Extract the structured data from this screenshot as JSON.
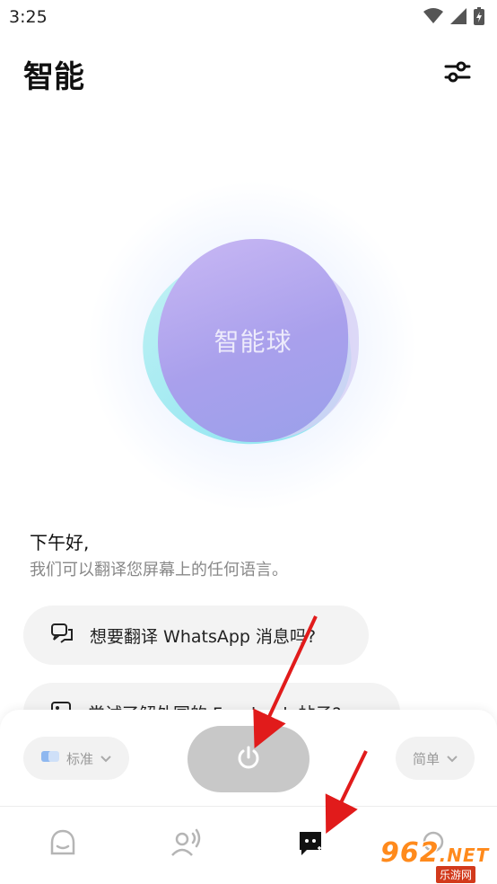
{
  "status_bar": {
    "time": "3:25"
  },
  "header": {
    "title": "智能"
  },
  "orb": {
    "label": "智能球"
  },
  "greeting": {
    "title": "下午好,",
    "subtitle": "我们可以翻译您屏幕上的任何语言。"
  },
  "suggestions": [
    {
      "label": "想要翻译 WhatsApp 消息吗?",
      "icon": "chat-bubbles-icon"
    },
    {
      "label": "尝试了解外国的 Facebook 帖子?",
      "icon": "image-icon"
    }
  ],
  "controls": {
    "mode_label": "标准",
    "style_label": "简单",
    "power_icon": "power-icon"
  },
  "bottom_nav": [
    {
      "icon": "face-icon"
    },
    {
      "icon": "voice-user-icon"
    },
    {
      "icon": "ghost-chat-icon",
      "active": true
    },
    {
      "icon": "search-icon"
    }
  ],
  "watermark": {
    "text": "962",
    "suffix": ".NET",
    "sub": "乐游网"
  },
  "colors": {
    "accent": "#111111",
    "orb": "#a9a0ec",
    "power_button": "#c8c8c8",
    "pill_bg": "#f2f2f2"
  }
}
